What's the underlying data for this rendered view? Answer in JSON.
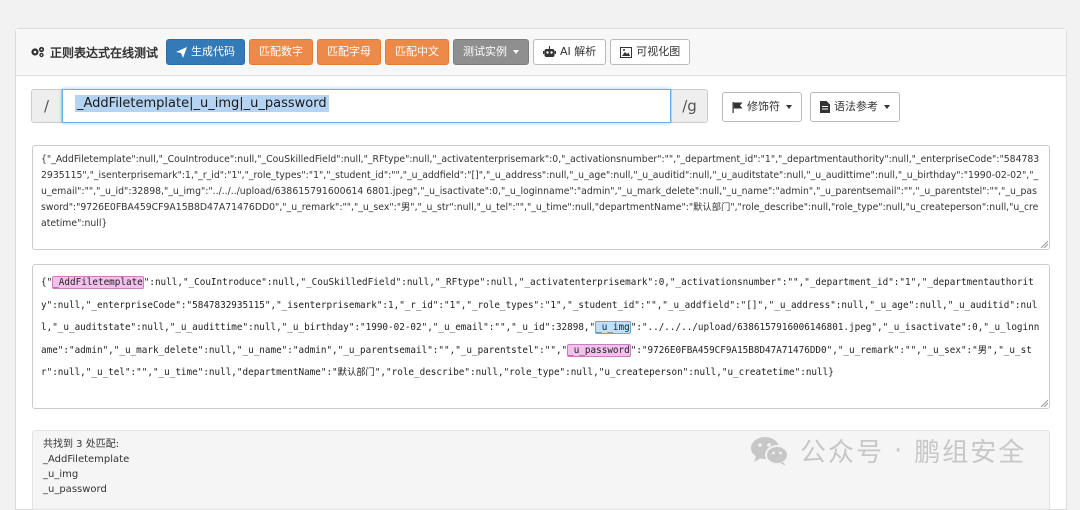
{
  "toolbar": {
    "title": "正则表达式在线测试",
    "generate_code": "生成代码",
    "match_digits": "匹配数字",
    "match_letters": "匹配字母",
    "match_chinese": "匹配中文",
    "test_examples": "测试实例",
    "ai_analysis": "AI 解析",
    "visualize": "可视化图"
  },
  "regex": {
    "open_delim": "/",
    "pattern": "_AddFiletemplate|_u_img|_u_password",
    "close_delim": "/g",
    "modifiers_label": "修饰符",
    "syntax_ref_label": "语法参考"
  },
  "source_text": "{\"_AddFiletemplate\":null,\"_CouIntroduce\":null,\"_CouSkilledField\":null,\"_RFtype\":null,\"_activatenterprisemark\":0,\"_activationsnumber\":\"\",\"_department_id\":\"1\",\"_departmentauthority\":null,\"_enterpriseCode\":\"5847832935115\",\"_isenterprisemark\":1,\"_r_id\":\"1\",\"_role_types\":\"1\",\"_student_id\":\"\",\"_u_addfield\":\"[]\",\"_u_address\":null,\"_u_age\":null,\"_u_auditid\":null,\"_u_auditstate\":null,\"_u_audittime\":null,\"_u_birthday\":\"1990-02-02\",\"_u_email\":\"\",\"_u_id\":32898,\"_u_img\":\"../../../upload/638615791600614 6801.jpeg\",\"_u_isactivate\":0,\"_u_loginname\":\"admin\",\"_u_mark_delete\":null,\"_u_name\":\"admin\",\"_u_parentsemail\":\"\",\"_u_parentstel\":\"\",\"_u_password\":\"9726E0FBA459CF9A15B8D47A71476DD0\",\"_u_remark\":\"\",\"_u_sex\":\"男\",\"_u_str\":null,\"_u_tel\":\"\",\"_u_time\":null,\"departmentName\":\"默认部门\",\"role_describe\":null,\"role_type\":null,\"u_createperson\":null,\"u_createtime\":null}",
  "highlight": {
    "seg0": "{\"",
    "match1": "_AddFiletemplate",
    "seg1": "\":null,\"_CouIntroduce\":null,\"_CouSkilledField\":null,\"_RFtype\":null,\"_activatenterprisemark\":0,\"_activationsnumber\":\"\",\"_department_id\":\"1\",\"_departmentauthority\":null,\"_enterpriseCode\":\"5847832935115\",\"_isenterprisemark\":1,\"_r_id\":\"1\",\"_role_types\":\"1\",\"_student_id\":\"\",\"_u_addfield\":\"[]\",\"_u_address\":null,\"_u_age\":null,\"_u_auditid\":null,\"_u_auditstate\":null,\"_u_audittime\":null,\"_u_birthday\":\"1990-02-02\",\"_u_email\":\"\",\"_u_id\":32898,\"",
    "match2": "_u_img",
    "seg2": "\":\"../../../upload/6386157916006146801.jpeg\",\"_u_isactivate\":0,\"_u_loginname\":\"admin\",\"_u_mark_delete\":null,\"_u_name\":\"admin\",\"_u_parentsemail\":\"\",\"_u_parentstel\":\"\",\"",
    "match3": "_u_password",
    "seg3": "\":\"9726E0FBA459CF9A15B8D47A71476DD0\",\"_u_remark\":\"\",\"_u_sex\":\"男\",\"_u_str\":null,\"_u_tel\":\"\",\"_u_time\":null,\"departmentName\":\"默认部门\",\"role_describe\":null,\"role_type\":null,\"u_createperson\":null,\"u_createtime\":null}"
  },
  "result": {
    "summary": "共找到 3 处匹配:",
    "matches": [
      "_AddFiletemplate",
      "_u_img",
      "_u_password"
    ]
  },
  "watermark": {
    "account": "公众号",
    "separator": "·",
    "name": "鹏组安全"
  },
  "colors": {
    "primary": "#337ab7",
    "orange": "#ec8a4a",
    "gray": "#8f8f8f",
    "match_pink": "#f1c0ec",
    "match_blue": "#bfe0f7"
  }
}
